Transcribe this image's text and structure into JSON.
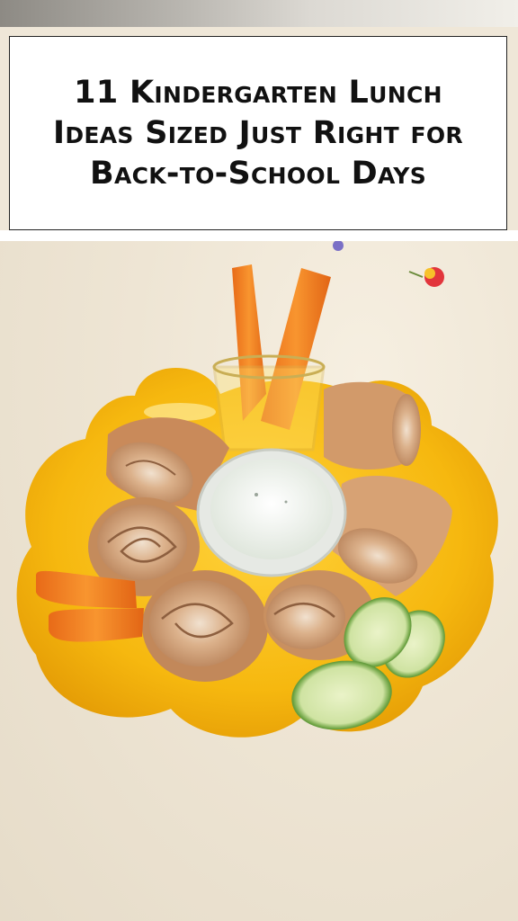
{
  "pin": {
    "title": "11 Kindergarten Lunch Ideas Sized Just Right for Back-to-School Days"
  },
  "photo": {
    "subject": "food-photo",
    "colors": {
      "background": "#efe7d8",
      "plate": "#f6b80f",
      "tortilla": "#d9a070",
      "carrot": "#f07a22",
      "dip": "#f4f6f2",
      "cucumber": "#5e9a3c"
    }
  }
}
